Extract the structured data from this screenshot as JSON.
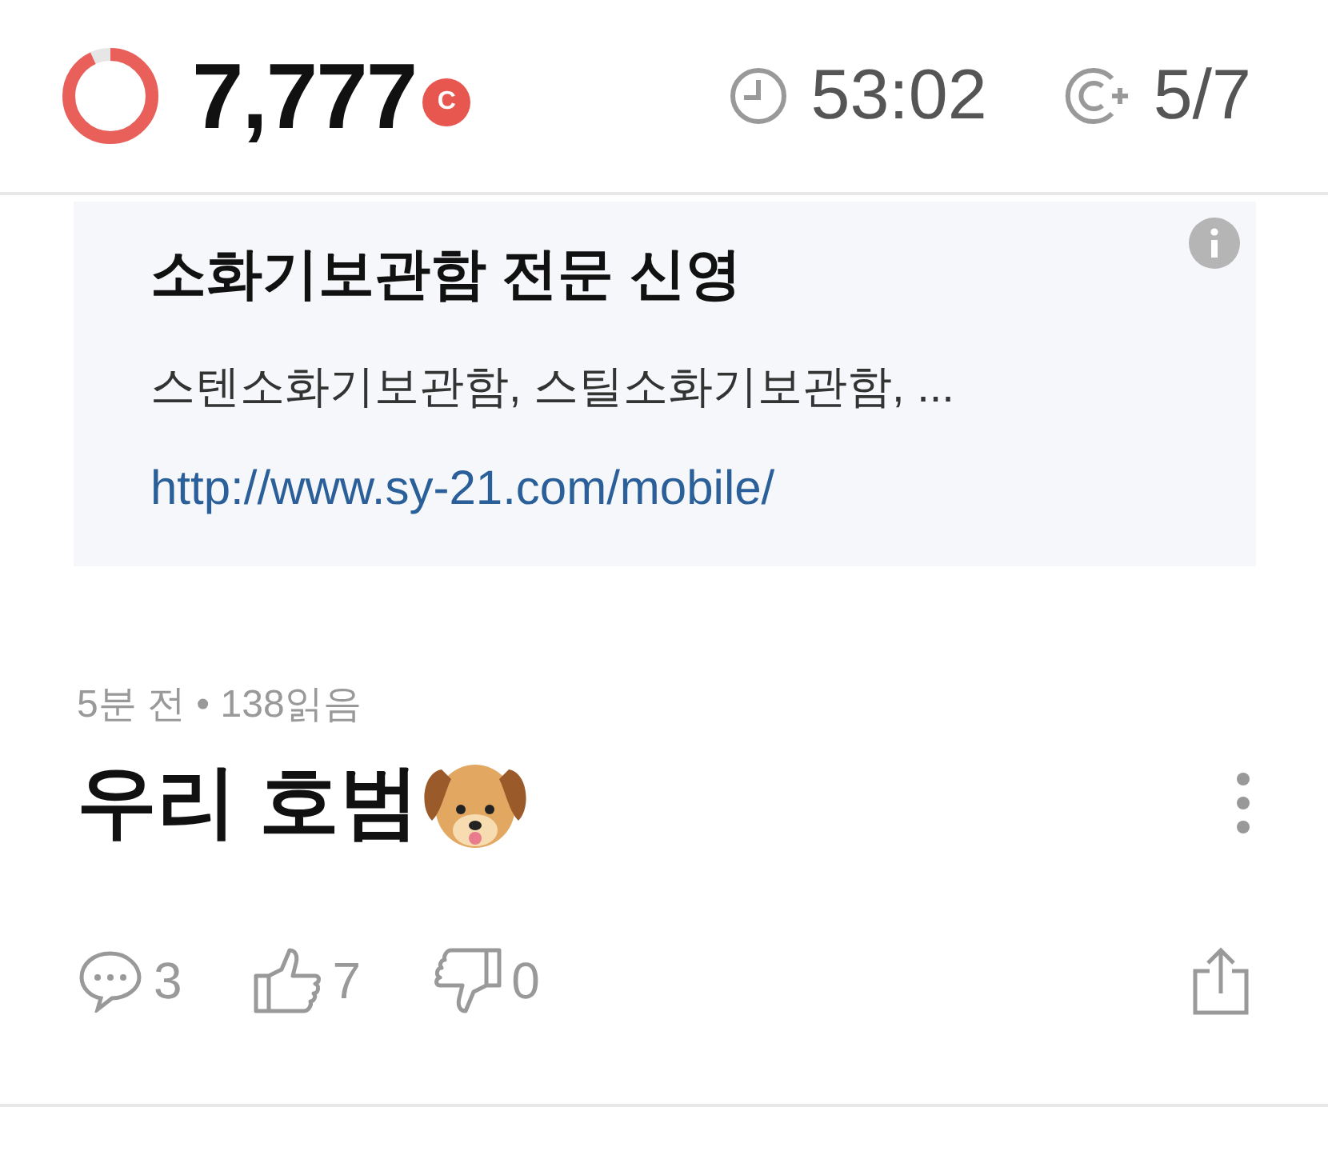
{
  "header": {
    "points": "7,777",
    "points_badge": "C",
    "timer": "53:02",
    "count": "5/7"
  },
  "ad": {
    "title": "소화기보관함 전문 신영",
    "description": "스텐소화기보관함, 스틸소화기보관함, ...",
    "url": "http://www.sy-21.com/mobile/"
  },
  "post": {
    "time": "5분 전",
    "separator": "•",
    "reads": "138읽음",
    "title": "우리 호범",
    "comments": "3",
    "likes": "7",
    "dislikes": "0"
  }
}
